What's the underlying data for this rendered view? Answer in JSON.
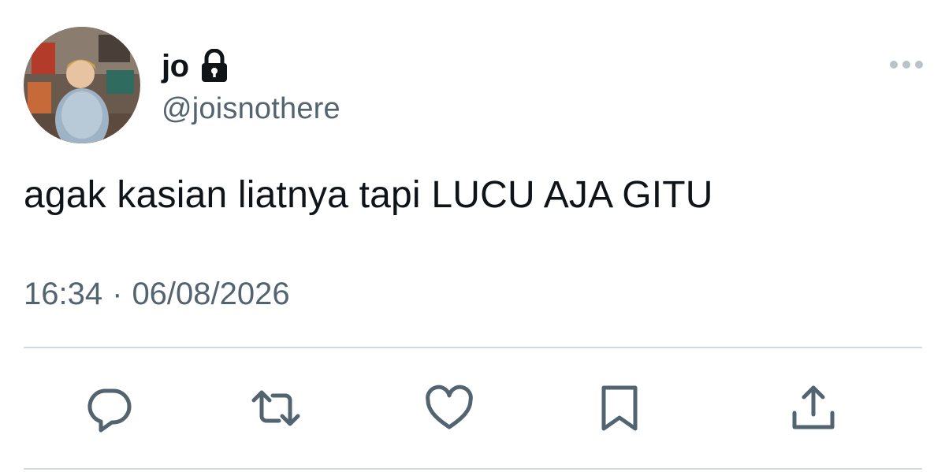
{
  "tweet": {
    "author": {
      "display_name": "jo",
      "handle": "@joisnothere",
      "protected_icon": "lock-icon",
      "avatar": "avatar-photo"
    },
    "text": "agak kasian liatnya tapi LUCU AJA GITU",
    "time": "16:34",
    "separator": "·",
    "date": "06/08/2026"
  },
  "actions": [
    {
      "name": "reply",
      "icon": "reply-icon"
    },
    {
      "name": "retweet",
      "icon": "retweet-icon"
    },
    {
      "name": "like",
      "icon": "heart-icon"
    },
    {
      "name": "bookmark",
      "icon": "bookmark-icon"
    },
    {
      "name": "share",
      "icon": "share-icon"
    }
  ],
  "menu": {
    "icon": "more-options-icon"
  },
  "colors": {
    "text": "#0f1419",
    "secondary": "#536471",
    "divider": "#cfd9de",
    "icon": "#536471"
  }
}
